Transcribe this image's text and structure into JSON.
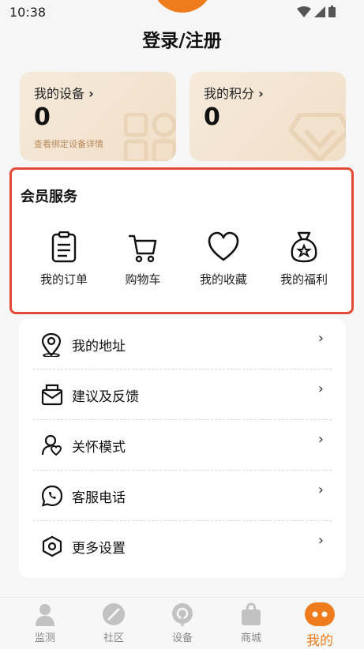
{
  "status_bar": {
    "time": "10:38"
  },
  "header": {
    "login_label": "登录/注册"
  },
  "cards": {
    "devices": {
      "label": "我的设备",
      "value": "0",
      "sub": "查看绑定设备详情"
    },
    "points": {
      "label": "我的积分",
      "value": "0"
    }
  },
  "member": {
    "title": "会员服务",
    "items": [
      {
        "label": "我的订单",
        "icon": "clipboard-icon"
      },
      {
        "label": "购物车",
        "icon": "cart-icon"
      },
      {
        "label": "我的收藏",
        "icon": "heart-icon"
      },
      {
        "label": "我的福利",
        "icon": "gift-bag-icon"
      }
    ]
  },
  "menu": {
    "chevron": "›",
    "items": [
      {
        "label": "我的地址",
        "icon": "location-pin-icon"
      },
      {
        "label": "建议及反馈",
        "icon": "feedback-icon"
      },
      {
        "label": "关怀模式",
        "icon": "care-icon"
      },
      {
        "label": "客服电话",
        "icon": "phone-icon"
      },
      {
        "label": "更多设置",
        "icon": "settings-icon"
      }
    ]
  },
  "tabbar": {
    "items": [
      {
        "label": "监测",
        "icon": "person-icon"
      },
      {
        "label": "社区",
        "icon": "community-icon"
      },
      {
        "label": "设备",
        "icon": "device-icon"
      },
      {
        "label": "商城",
        "icon": "shop-bag-icon"
      },
      {
        "label": "我的",
        "icon": "mine-icon",
        "active": true
      }
    ]
  },
  "colors": {
    "accent": "#ef7c1c",
    "highlight_border": "#e24a35",
    "card_bg": "#f6eadb"
  }
}
